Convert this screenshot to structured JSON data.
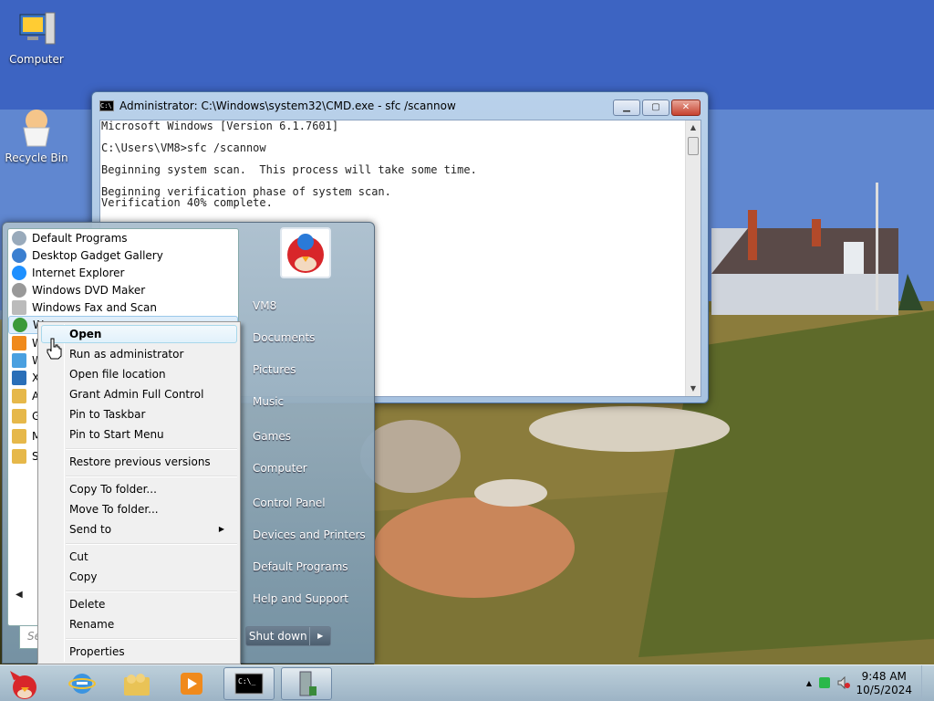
{
  "desktop": {
    "icons": [
      {
        "label": "Computer"
      },
      {
        "label": "Recycle Bin"
      }
    ]
  },
  "cmd": {
    "title": "Administrator: C:\\Windows\\system32\\CMD.exe - sfc  /scannow",
    "lines": [
      "Microsoft Windows [Version 6.1.7601]",
      "",
      "C:\\Users\\VM8>sfc /scannow",
      "",
      "Beginning system scan.  This process will take some time.",
      "",
      "Beginning verification phase of system scan.",
      "Verification 40% complete."
    ]
  },
  "start_menu": {
    "programs": [
      {
        "label": "Default Programs",
        "icon": "default-programs-icon"
      },
      {
        "label": "Desktop Gadget Gallery",
        "icon": "gadget-gallery-icon"
      },
      {
        "label": "Internet Explorer",
        "icon": "internet-explorer-icon"
      },
      {
        "label": "Windows DVD Maker",
        "icon": "dvd-maker-icon"
      },
      {
        "label": "Windows Fax and Scan",
        "icon": "fax-scan-icon"
      },
      {
        "label": "W",
        "icon": "media-center-icon"
      },
      {
        "label": "W",
        "icon": "media-player-icon"
      },
      {
        "label": "W",
        "icon": "windows-update-icon"
      },
      {
        "label": "X",
        "icon": "xps-viewer-icon"
      },
      {
        "label": "A",
        "icon": "folder-icon"
      },
      {
        "label": "G",
        "icon": "folder-icon"
      },
      {
        "label": "M",
        "icon": "folder-icon"
      },
      {
        "label": "St",
        "icon": "folder-icon"
      }
    ],
    "search_placeholder": "Se",
    "user": "VM8",
    "right_items": [
      "Documents",
      "Pictures",
      "Music",
      "Games",
      "Computer",
      "Control Panel",
      "Devices and Printers",
      "Default Programs",
      "Help and Support"
    ],
    "shutdown": "Shut down"
  },
  "context_menu": {
    "items": [
      {
        "label": "Open",
        "bold": true
      },
      {
        "label": "Run as administrator"
      },
      {
        "label": "Open file location"
      },
      {
        "label": "Grant Admin Full Control"
      },
      {
        "label": "Pin to Taskbar"
      },
      {
        "label": "Pin to Start Menu"
      },
      {
        "label": "Restore previous versions"
      },
      {
        "label": "Copy To folder..."
      },
      {
        "label": "Move To folder..."
      },
      {
        "label": "Send to"
      },
      {
        "label": "Cut"
      },
      {
        "label": "Copy"
      },
      {
        "label": "Delete"
      },
      {
        "label": "Rename"
      },
      {
        "label": "Properties"
      }
    ]
  },
  "taskbar": {
    "clock_time": "9:48 AM",
    "clock_date": "10/5/2024"
  },
  "colors": {
    "accent": "#4a6fa0",
    "highlight": "#a8d8eb"
  }
}
